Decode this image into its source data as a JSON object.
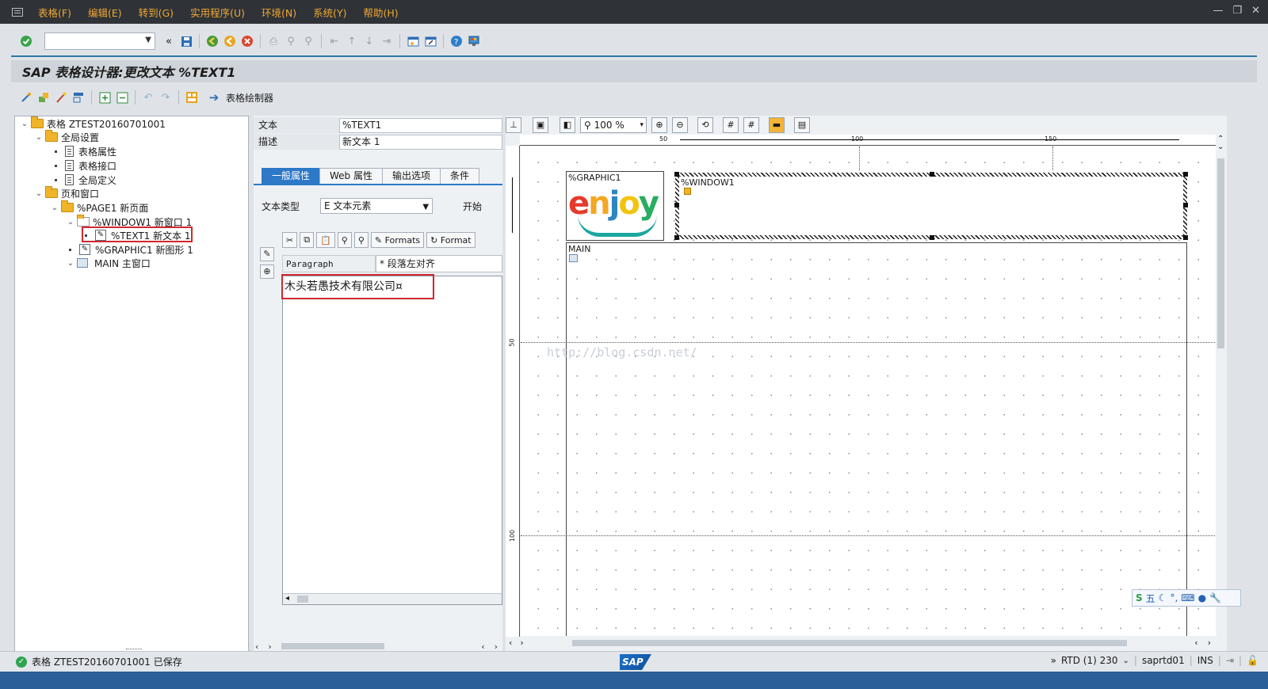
{
  "menu": {
    "items": [
      "表格(F)",
      "编辑(E)",
      "转到(G)",
      "实用程序(U)",
      "环境(N)",
      "系统(Y)",
      "帮助(H)"
    ]
  },
  "window_controls": [
    "—",
    "❐",
    "✕"
  ],
  "title": "SAP 表格设计器:更改文本 %TEXT1",
  "app_toolbar": {
    "form_painter_label": "表格绘制器"
  },
  "tree": {
    "root": "表格 ZTEST20160701001",
    "global_settings": "全局设置",
    "form_attributes": "表格属性",
    "form_interface": "表格接口",
    "global_definitions": "全局定义",
    "pages_windows": "页和窗口",
    "page1": "%PAGE1 新页面",
    "window1": "%WINDOW1 新窗口 1",
    "text1": "%TEXT1 新文本 1",
    "graphic1": "%GRAPHIC1 新图形 1",
    "main": "MAIN 主窗口"
  },
  "fields": {
    "text_label": "文本",
    "text_value": "%TEXT1",
    "desc_label": "描述",
    "desc_value": "新文本 1"
  },
  "tabs": [
    "一般属性",
    "Web 属性",
    "输出选项",
    "条件"
  ],
  "text_type": {
    "label": "文本类型",
    "value": "E 文本元素",
    "start_label": "开始"
  },
  "editor": {
    "formats_btn": "Formats",
    "formats_btn2": "Format",
    "paragraph_label": "Paragraph Formats",
    "paragraph_value": "* 段落左对齐",
    "content": "木头若愚技术有限公司¤"
  },
  "canvas": {
    "zoom": "100 %",
    "ruler_top": [
      "50",
      "100",
      "150"
    ],
    "ruler_left": [
      "50",
      "100"
    ],
    "graphic_label": "%GRAPHIC1",
    "logo_text": "enjoy",
    "window1_label": "%WINDOW1",
    "main_label": "MAIN",
    "watermark": "http://blog.csdn.net/"
  },
  "ime": {
    "mode": "五"
  },
  "status": {
    "message": "表格 ZTEST20160701001 已保存",
    "system": "RTD (1) 230",
    "server": "saprtd01",
    "mode": "INS",
    "logo": "SAP"
  },
  "colors": {
    "menu_text": "#f0a733",
    "accent": "#2d79c7",
    "highlight_box": "#d0282f"
  }
}
